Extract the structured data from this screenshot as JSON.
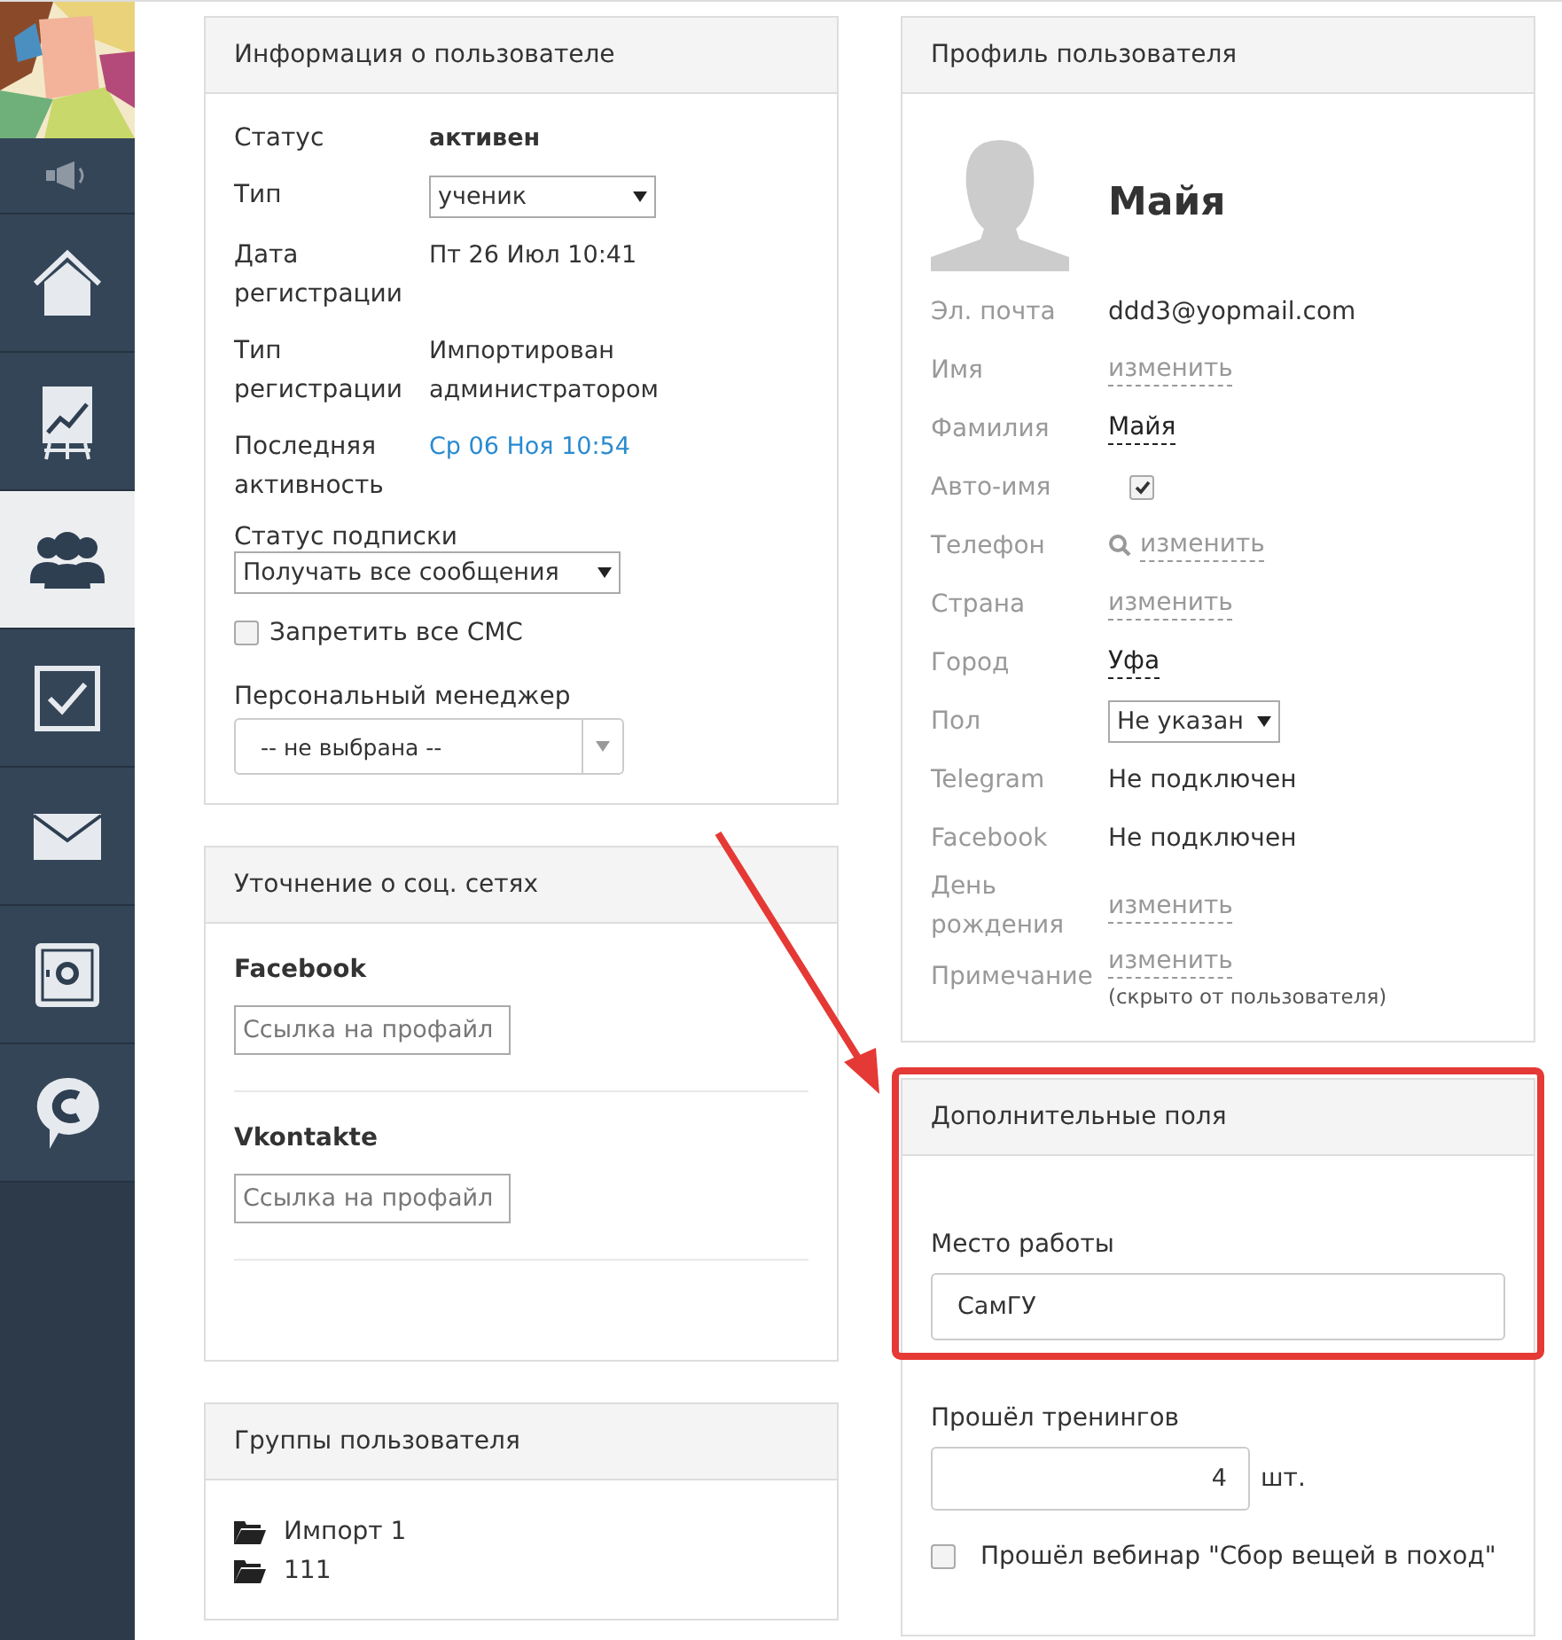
{
  "sidebar": {
    "items": [
      {
        "selected": false
      },
      {
        "selected": false
      },
      {
        "selected": false
      },
      {
        "selected": true
      },
      {
        "selected": false
      },
      {
        "selected": false
      },
      {
        "selected": false
      },
      {
        "selected": false
      }
    ]
  },
  "user_info": {
    "title": "Информация о пользователе",
    "rows": [
      {
        "label": "Статус",
        "value": "активен",
        "kind": "bold"
      },
      {
        "label": "Тип",
        "value": "ученик",
        "kind": "select"
      },
      {
        "label": "Дата регистрации",
        "value": "Пт 26 Июл 10:41",
        "kind": "text"
      },
      {
        "label": "Тип регистрации",
        "value": "Импортирован администратором",
        "kind": "text"
      },
      {
        "label": "Последняя активность",
        "value": "Ср 06 Ноя 10:54",
        "kind": "link"
      }
    ],
    "subscription": {
      "label": "Статус подписки",
      "value": "Получать все сообщения"
    },
    "sms": {
      "label": "Запретить все СМС",
      "checked": false
    },
    "manager": {
      "label": "Персональный менеджер",
      "value": "-- не выбрана --"
    }
  },
  "social": {
    "title": "Уточнение о соц. сетях",
    "networks": [
      {
        "name": "Facebook",
        "placeholder": "Ссылка на профайл"
      },
      {
        "name": "Vkontakte",
        "placeholder": "Ссылка на профайл"
      }
    ]
  },
  "groups": {
    "title": "Группы пользователя",
    "items": [
      "Импорт 1",
      "111"
    ]
  },
  "profile": {
    "title": "Профиль пользователя",
    "name": "Майя",
    "fields": [
      {
        "label": "Эл. почта",
        "kind": "text",
        "value": "ddd3@yopmail.com"
      },
      {
        "label": "Имя",
        "kind": "edit",
        "value": "изменить",
        "empty": true
      },
      {
        "label": "Фамилия",
        "kind": "edit",
        "value": "Майя",
        "empty": false
      },
      {
        "label": "Авто-имя",
        "kind": "checkbox",
        "checked": true
      },
      {
        "label": "Телефон",
        "kind": "phone",
        "value": "изменить"
      },
      {
        "label": "Страна",
        "kind": "edit",
        "value": "изменить",
        "empty": true
      },
      {
        "label": "Город",
        "kind": "edit",
        "value": "Уфа",
        "empty": false
      },
      {
        "label": "Пол",
        "kind": "select",
        "value": "Не указан"
      },
      {
        "label": "Telegram",
        "kind": "text",
        "value": "Не подключен"
      },
      {
        "label": "Facebook",
        "kind": "text",
        "value": "Не подключен"
      },
      {
        "label": "День рождения",
        "kind": "edit",
        "value": "изменить",
        "empty": true
      },
      {
        "label": "Примечание",
        "kind": "note",
        "value": "изменить",
        "hint": "(скрыто от пользователя)"
      }
    ]
  },
  "extra": {
    "title": "Дополнительные поля",
    "fields": [
      {
        "kind": "text",
        "label": "Место работы",
        "value": "СамГУ"
      },
      {
        "kind": "number",
        "label": "Прошёл тренингов",
        "value": "4",
        "unit": "шт."
      },
      {
        "kind": "checkbox",
        "label": "Прошёл вебинар \"Сбор вещей в поход\"",
        "checked": false
      }
    ]
  }
}
